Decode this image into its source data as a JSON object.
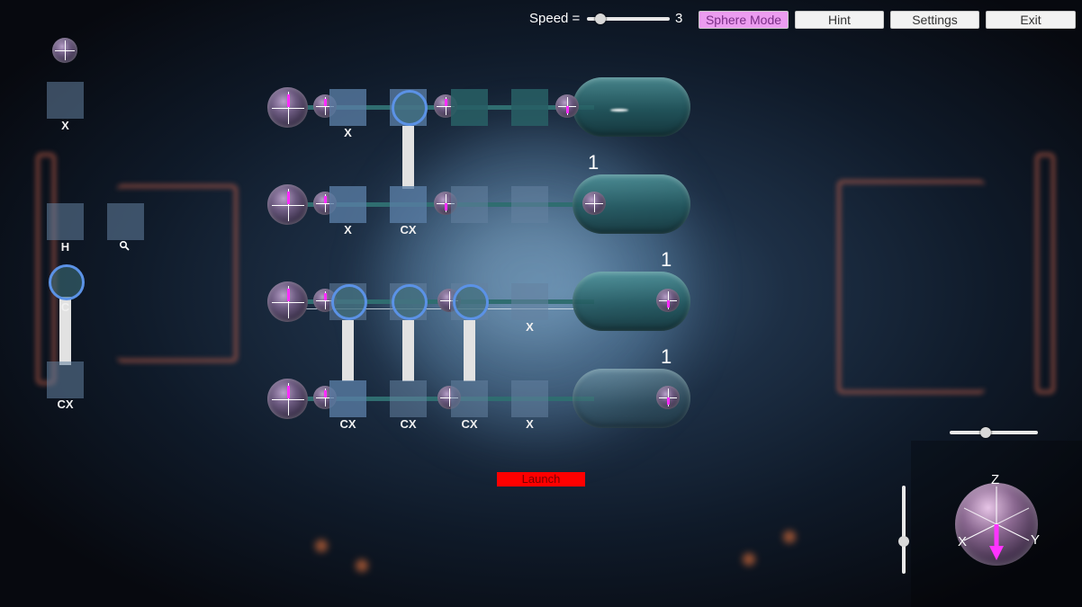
{
  "topbar": {
    "speed_label": "Speed =",
    "speed_value": "3",
    "speed_level": 0.1,
    "sphere_mode_label": "Sphere Mode",
    "hint_label": "Hint",
    "settings_label": "Settings",
    "exit_label": "Exit"
  },
  "palette": {
    "x_gate_label": "X",
    "h_gate_label": "H",
    "cx_gate_label": "CX",
    "control_label": "C",
    "magnifier_icon": "magnifier-icon"
  },
  "circuit": {
    "rows": [
      {
        "gates": [
          "X",
          "C",
          "",
          ""
        ],
        "count": ""
      },
      {
        "gates": [
          "X",
          "CX",
          "",
          ""
        ],
        "count": "1"
      },
      {
        "gates": [
          "",
          "C",
          "C",
          "C",
          "X"
        ],
        "count": "1"
      },
      {
        "gates": [
          "CX",
          "CX",
          "CX",
          "X"
        ],
        "count": "1"
      }
    ],
    "row1_gate1": "X",
    "row1_gate2": "C",
    "row2_gate1": "X",
    "row2_gate2": "CX",
    "row2_count": "1",
    "row3_c1": "C",
    "row3_c2": "C",
    "row3_c3": "C",
    "row3_x": "X",
    "row3_count": "1",
    "row4_cx1": "CX",
    "row4_cx2": "CX",
    "row4_cx3": "CX",
    "row4_x": "X",
    "row4_count": "1"
  },
  "measure_button": "Launch",
  "bloch": {
    "z_label": "Z",
    "x_label": "X",
    "y_label": "Y",
    "arrow_color": "#ff33ff"
  },
  "colors": {
    "sphere_mode_bg": "#ec9cf0",
    "measure_bg": "#ff0000",
    "control_ring": "#5b92e6"
  }
}
